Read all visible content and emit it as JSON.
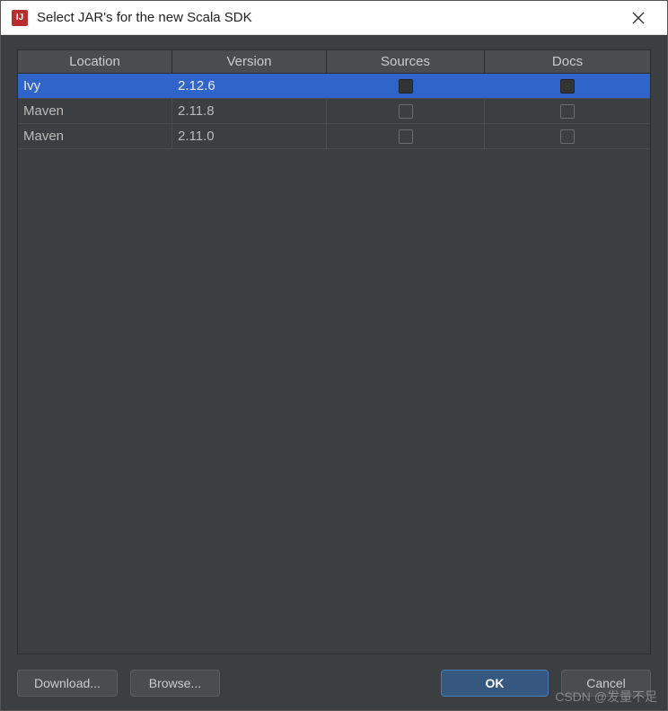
{
  "titlebar": {
    "app_icon_text": "IJ",
    "title": "Select JAR's for the new Scala SDK"
  },
  "table": {
    "headers": {
      "location": "Location",
      "version": "Version",
      "sources": "Sources",
      "docs": "Docs"
    },
    "rows": [
      {
        "location": "Ivy",
        "version": "2.12.6",
        "sources": false,
        "docs": false,
        "selected": true
      },
      {
        "location": "Maven",
        "version": "2.11.8",
        "sources": false,
        "docs": false,
        "selected": false
      },
      {
        "location": "Maven",
        "version": "2.11.0",
        "sources": false,
        "docs": false,
        "selected": false
      }
    ]
  },
  "buttons": {
    "download": "Download...",
    "browse": "Browse...",
    "ok": "OK",
    "cancel": "Cancel"
  },
  "watermark": "CSDN @发量不足"
}
